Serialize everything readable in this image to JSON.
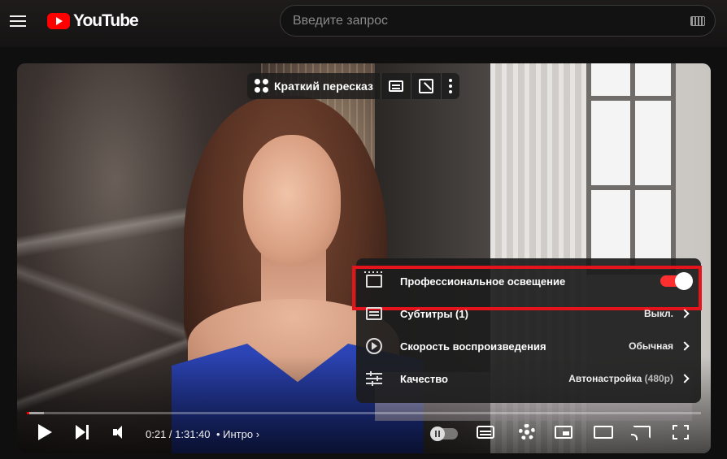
{
  "header": {
    "logo_text": "YouTube",
    "search_placeholder": "Введите запрос"
  },
  "overlay": {
    "summary_label": "Краткий пересказ"
  },
  "settings_menu": {
    "items": [
      {
        "label": "Профессиональное освещение",
        "value": "",
        "icon": "ambient-lighting-icon",
        "toggle_on": true
      },
      {
        "label": "Субтитры (1)",
        "value": "Выкл.",
        "icon": "subtitles-icon"
      },
      {
        "label": "Скорость воспроизведения",
        "value": "Обычная",
        "icon": "playback-speed-icon"
      },
      {
        "label": "Качество",
        "value": "Автонастройка",
        "value_extra": "(480p)",
        "icon": "quality-icon"
      }
    ]
  },
  "controls": {
    "time": "0:21 / 1:31:40",
    "chapter": "• Интро",
    "progress_played_fraction": 0.004,
    "progress_loaded_fraction": 0.025
  },
  "colors": {
    "brand": "#ff0000",
    "highlight_border": "#e3141b",
    "toggle_on": "#ff2f2f"
  }
}
